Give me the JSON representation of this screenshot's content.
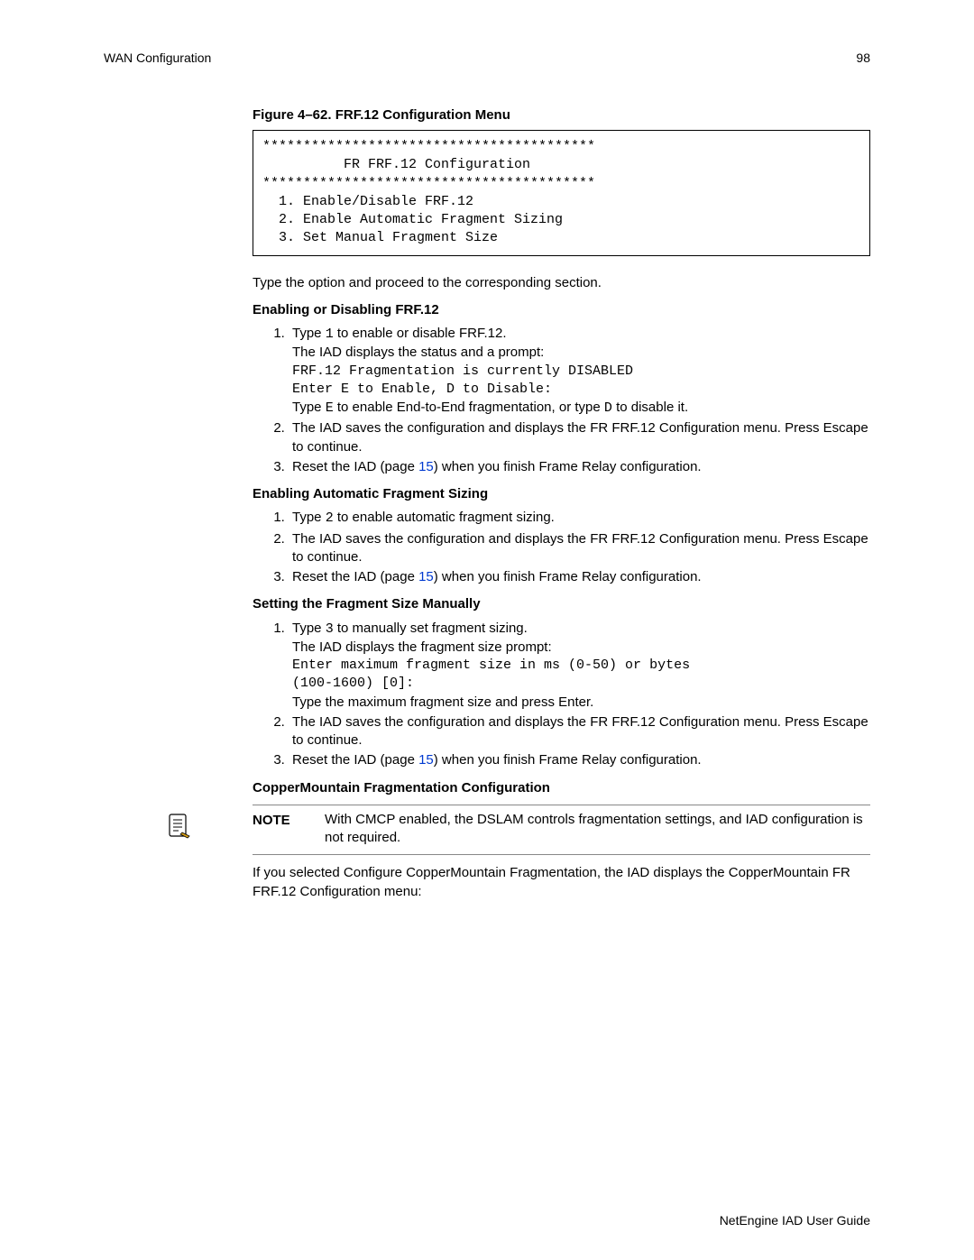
{
  "running_head": {
    "left": "WAN Configuration",
    "right": "98"
  },
  "figure": {
    "caption": "Figure 4–62.  FRF.12 Configuration Menu",
    "box": "*****************************************\n          FR FRF.12 Configuration\n*****************************************\n  1. Enable/Disable FRF.12\n  2. Enable Automatic Fragment Sizing\n  3. Set Manual Fragment Size"
  },
  "intro_after_figure": "Type the option and proceed to the corresponding section.",
  "section1": {
    "heading": "Enabling or Disabling FRF.12",
    "step1_a": "Type ",
    "step1_code": "1",
    "step1_b": " to enable or disable FRF.12.",
    "step1_line2": "The IAD displays the status and a prompt:",
    "step1_code_block": "FRF.12 Fragmentation is currently DISABLED\nEnter E to Enable, D to Disable:",
    "step1_line3_a": "Type ",
    "step1_line3_code1": "E",
    "step1_line3_b": " to enable End-to-End fragmentation, or type ",
    "step1_line3_code2": "D",
    "step1_line3_c": " to disable it.",
    "step2": "The IAD saves the configuration and displays the FR FRF.12 Configuration menu. Press Escape to continue.",
    "step3_a": "Reset the IAD (page ",
    "step3_link": "15",
    "step3_b": ") when you finish Frame Relay configuration."
  },
  "section2": {
    "heading": "Enabling Automatic Fragment Sizing",
    "step1_a": "Type ",
    "step1_code": "2",
    "step1_b": " to enable automatic fragment sizing.",
    "step2": "The IAD saves the configuration and displays the FR FRF.12 Configuration menu. Press Escape to continue.",
    "step3_a": "Reset the IAD (page ",
    "step3_link": "15",
    "step3_b": ") when you finish Frame Relay configuration."
  },
  "section3": {
    "heading": "Setting the Fragment Size Manually",
    "step1_a": "Type ",
    "step1_code": "3",
    "step1_b": " to manually set fragment sizing.",
    "step1_line2": "The IAD displays the fragment size prompt:",
    "step1_code_block": "Enter maximum fragment size in ms (0-50) or bytes\n(100-1600) [0]:",
    "step1_line3": "Type the maximum fragment size and press Enter.",
    "step2": "The IAD saves the configuration and displays the FR FRF.12 Configuration menu. Press Escape to continue.",
    "step3_a": "Reset the IAD (page ",
    "step3_link": "15",
    "step3_b": ") when you finish Frame Relay configuration."
  },
  "section4": {
    "heading": "CopperMountain Fragmentation Configuration",
    "note_label": "NOTE",
    "note_text": "With CMCP enabled, the DSLAM controls fragmentation settings, and IAD configuration is not required.",
    "after_note": "If you selected Configure CopperMountain Fragmentation, the IAD displays the CopperMountain FR FRF.12 Configuration menu:"
  },
  "footer": "NetEngine IAD User Guide"
}
